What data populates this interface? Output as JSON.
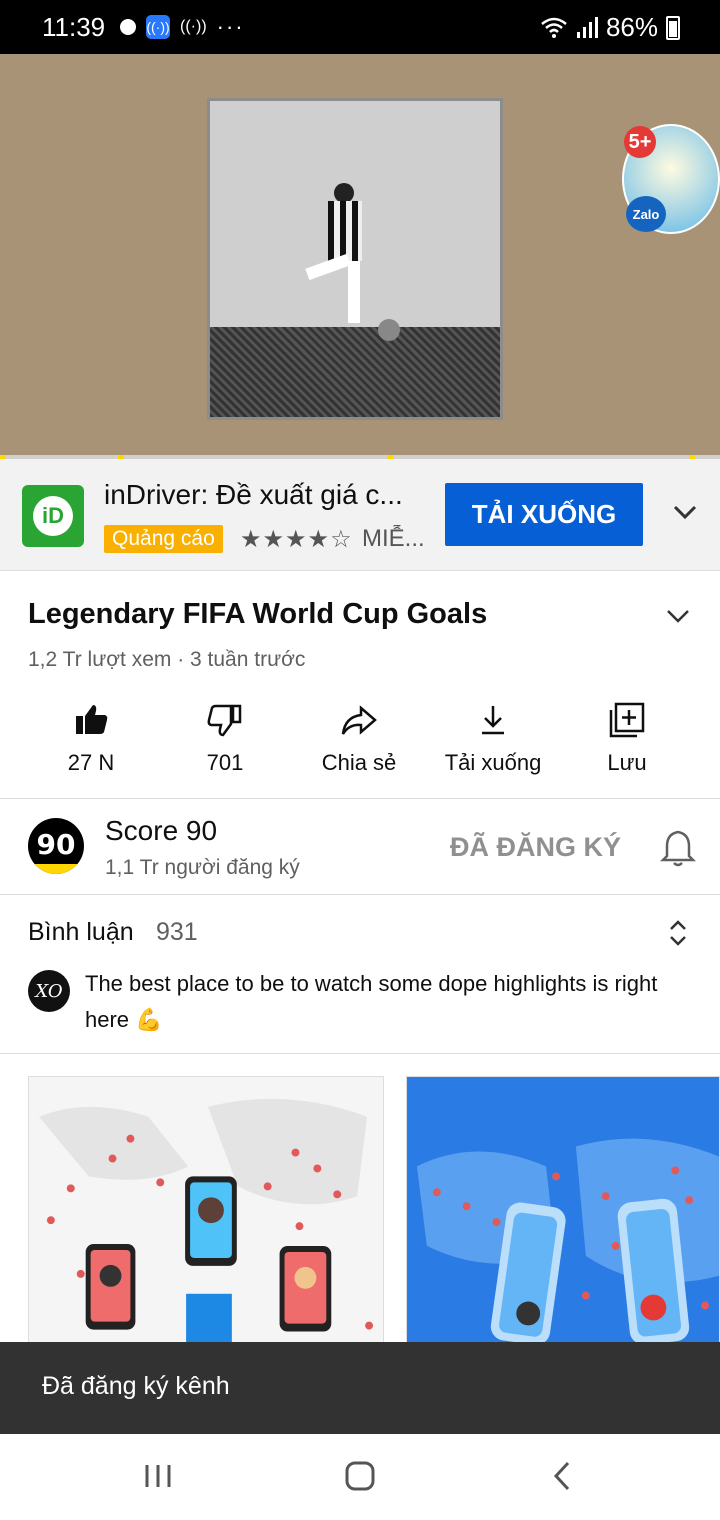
{
  "status_bar": {
    "time": "11:39",
    "battery": "86%"
  },
  "ad": {
    "title": "inDriver: Đề xuất giá c...",
    "badge": "Quảng cáo",
    "rating_stars": "★★★★☆",
    "price": "MIỄ...",
    "cta_label": "TẢI XUỐNG",
    "icon_text": "iD"
  },
  "video": {
    "title": "Legendary FIFA World Cup Goals",
    "meta": "1,2 Tr lượt xem · 3 tuần trước",
    "overlay_count": "5+",
    "overlay_brand": "Zalo"
  },
  "actions": {
    "like": "27 N",
    "dislike": "701",
    "share": "Chia sẻ",
    "download": "Tải xuống",
    "save": "Lưu"
  },
  "channel": {
    "avatar_text": "90",
    "name": "Score 90",
    "subscribers": "1,1 Tr người đăng ký",
    "subscribe_state": "ĐÃ ĐĂNG KÝ"
  },
  "comments": {
    "label": "Bình luận",
    "count": "931",
    "top_comment": "The best place to be to watch some dope highlights is right here 💪",
    "avatar_text": "XO"
  },
  "snackbar": {
    "message": "Đã đăng ký kênh"
  },
  "colors": {
    "accent_blue": "#065fd4",
    "ad_badge": "#f9b000",
    "snackbar_bg": "#323232"
  }
}
